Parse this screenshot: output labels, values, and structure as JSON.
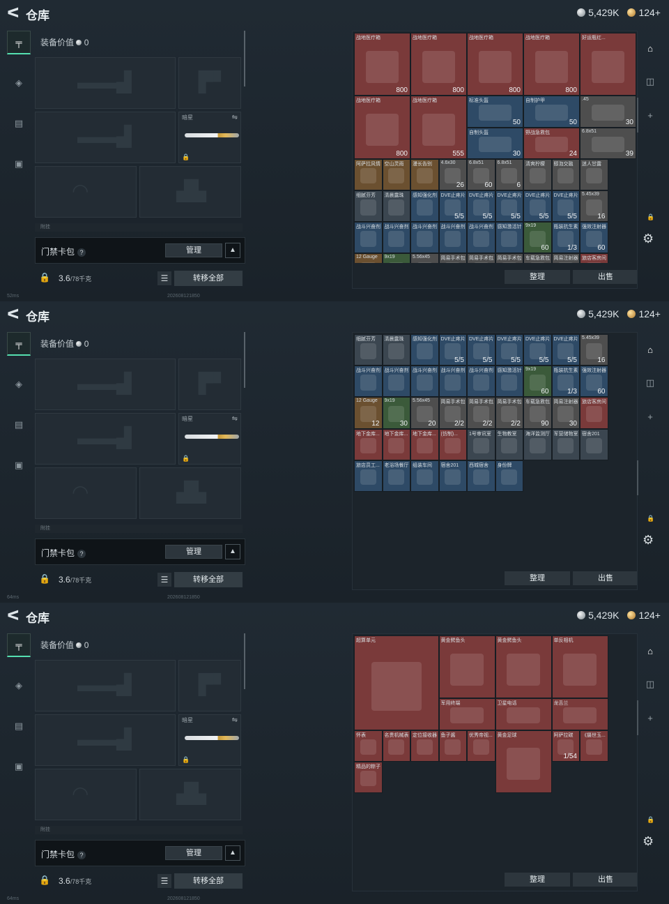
{
  "app": {
    "back_glyph": "ᐸ",
    "title": "仓库"
  },
  "currency": {
    "silver": "5,429K",
    "gold": "124+"
  },
  "loadout": {
    "equip_label": "装备价值",
    "equip_value": "0",
    "knife_slot_label": "暗星",
    "pouch_label": "附挂",
    "access_label": "门禁卡包",
    "access_help": "?",
    "manage_label": "管理",
    "weight": "3.6",
    "weight_max": "/78千克",
    "transfer_label": "转移全部"
  },
  "stash_toolbar": {
    "sort_label": "整理",
    "sell_label": "出售"
  },
  "status": {
    "ping1": "52ms",
    "ping2": "64ms",
    "ping3": "64ms",
    "stamp": "202608121850"
  },
  "left_icons": [
    "pistol-icon",
    "armor-icon",
    "backpack-icon",
    "briefcase-icon"
  ],
  "right_icons": [
    "vault-icon",
    "camera-icon",
    "plus-icon",
    "lock-icon",
    "gear-icon"
  ],
  "panels": [
    {
      "cells": [
        {
          "n": "战地医疗箱",
          "c": "800",
          "col": 0,
          "row": 0,
          "w": 1,
          "h": 2,
          "bg": "#7a3a3a"
        },
        {
          "n": "战地医疗箱",
          "c": "800",
          "col": 1,
          "row": 0,
          "w": 1,
          "h": 2,
          "bg": "#7a3a3a"
        },
        {
          "n": "战地医疗箱",
          "c": "800",
          "col": 2,
          "row": 0,
          "w": 1,
          "h": 2,
          "bg": "#7a3a3a"
        },
        {
          "n": "战地医疗箱",
          "c": "800",
          "col": 3,
          "row": 0,
          "w": 1,
          "h": 2,
          "bg": "#7a3a3a"
        },
        {
          "n": "好运瓶红...",
          "c": "",
          "col": 4,
          "row": 0,
          "w": 1,
          "h": 2,
          "bg": "#7a3a3a"
        },
        {
          "n": "战地医疗箱",
          "c": "800",
          "col": 0,
          "row": 2,
          "w": 1,
          "h": 2,
          "bg": "#7a3a3a"
        },
        {
          "n": "战地医疗箱",
          "c": "555",
          "col": 1,
          "row": 2,
          "w": 1,
          "h": 2,
          "bg": "#7a3a3a"
        },
        {
          "n": "标准头盔",
          "c": "50",
          "col": 2,
          "row": 2,
          "w": 1,
          "h": 1,
          "bg": "#2e4a66"
        },
        {
          "n": "自制护甲",
          "c": "50",
          "col": 3,
          "row": 2,
          "w": 1,
          "h": 1,
          "bg": "#2e4a66"
        },
        {
          "n": ".45",
          "c": "30",
          "col": 4,
          "row": 2,
          "w": 1,
          "h": 1,
          "bg": "#4e4e4e"
        },
        {
          "n": "自制头盔",
          "c": "30",
          "col": 2,
          "row": 3,
          "w": 1,
          "h": 1,
          "bg": "#2e4a66"
        },
        {
          "n": "野战急救包",
          "c": "24",
          "col": 3,
          "row": 3,
          "w": 1,
          "h": 1,
          "bg": "#7a3a3a"
        },
        {
          "n": "6.8x51",
          "c": "39",
          "col": 4,
          "row": 3,
          "w": 1,
          "h": 1,
          "bg": "#4e4e4e"
        },
        {
          "n": "阿萨拉风情",
          "c": "",
          "col": 0,
          "row": 4,
          "w": 0.5,
          "h": 1,
          "bg": "#6b5030"
        },
        {
          "n": "空山灵雨",
          "c": "",
          "col": 0.5,
          "row": 4,
          "w": 0.5,
          "h": 1,
          "bg": "#6b5030"
        },
        {
          "n": "漫长告别",
          "c": "",
          "col": 1,
          "row": 4,
          "w": 0.5,
          "h": 1,
          "bg": "#6b5030"
        },
        {
          "n": "4.6x30",
          "c": "26",
          "col": 1.5,
          "row": 4,
          "w": 0.5,
          "h": 1,
          "bg": "#4e4e4e"
        },
        {
          "n": "6.8x51",
          "c": "60",
          "col": 2,
          "row": 4,
          "w": 0.5,
          "h": 1,
          "bg": "#4e4e4e"
        },
        {
          "n": "6.8x51",
          "c": "6",
          "col": 2.5,
          "row": 4,
          "w": 0.5,
          "h": 1,
          "bg": "#4e4e4e"
        },
        {
          "n": "清爽柠檬",
          "c": "",
          "col": 3,
          "row": 4,
          "w": 0.5,
          "h": 1,
          "bg": "#4e4e4e"
        },
        {
          "n": "醇泡交融",
          "c": "",
          "col": 3.5,
          "row": 4,
          "w": 0.5,
          "h": 1,
          "bg": "#4e4e4e"
        },
        {
          "n": "迷人甘露",
          "c": "",
          "col": 4,
          "row": 4,
          "w": 0.5,
          "h": 1,
          "bg": "#4e4e4e"
        },
        {
          "n": "细腻芬芳",
          "c": "",
          "col": 0,
          "row": 5,
          "w": 0.5,
          "h": 1,
          "bg": "#3b4650"
        },
        {
          "n": "清晨露珠",
          "c": "",
          "col": 0.5,
          "row": 5,
          "w": 0.5,
          "h": 1,
          "bg": "#3b4650"
        },
        {
          "n": "感知强化剂",
          "c": "",
          "col": 1,
          "row": 5,
          "w": 0.5,
          "h": 1,
          "bg": "#2e4a66"
        },
        {
          "n": "DVE止疼片",
          "c": "5/5",
          "col": 1.5,
          "row": 5,
          "w": 0.5,
          "h": 1,
          "bg": "#2e4a66"
        },
        {
          "n": "DVE止疼片",
          "c": "5/5",
          "col": 2,
          "row": 5,
          "w": 0.5,
          "h": 1,
          "bg": "#2e4a66"
        },
        {
          "n": "DVE止疼片",
          "c": "5/5",
          "col": 2.5,
          "row": 5,
          "w": 0.5,
          "h": 1,
          "bg": "#2e4a66"
        },
        {
          "n": "DVE止疼片",
          "c": "5/5",
          "col": 3,
          "row": 5,
          "w": 0.5,
          "h": 1,
          "bg": "#2e4a66"
        },
        {
          "n": "DVE止疼片",
          "c": "5/5",
          "col": 3.5,
          "row": 5,
          "w": 0.5,
          "h": 1,
          "bg": "#2e4a66"
        },
        {
          "n": "5.45x39",
          "c": "16",
          "col": 4,
          "row": 5,
          "w": 0.5,
          "h": 1,
          "bg": "#4e4e4e"
        },
        {
          "n": "战斗兴奋剂",
          "c": "",
          "col": 0,
          "row": 6,
          "w": 0.5,
          "h": 1,
          "bg": "#2e4a66"
        },
        {
          "n": "战斗兴奋剂",
          "c": "",
          "col": 0.5,
          "row": 6,
          "w": 0.5,
          "h": 1,
          "bg": "#2e4a66"
        },
        {
          "n": "战斗兴奋剂",
          "c": "",
          "col": 1,
          "row": 6,
          "w": 0.5,
          "h": 1,
          "bg": "#2e4a66"
        },
        {
          "n": "战斗兴奋剂",
          "c": "",
          "col": 1.5,
          "row": 6,
          "w": 0.5,
          "h": 1,
          "bg": "#2e4a66"
        },
        {
          "n": "战斗兴奋剂",
          "c": "",
          "col": 2,
          "row": 6,
          "w": 0.5,
          "h": 1,
          "bg": "#2e4a66"
        },
        {
          "n": "感知激活针",
          "c": "",
          "col": 2.5,
          "row": 6,
          "w": 0.5,
          "h": 1,
          "bg": "#2e4a66"
        },
        {
          "n": "9x19",
          "c": "60",
          "col": 3,
          "row": 6,
          "w": 0.5,
          "h": 1,
          "bg": "#3b5a3a"
        },
        {
          "n": "瓶装抗生素",
          "c": "1/3",
          "col": 3.5,
          "row": 6,
          "w": 0.5,
          "h": 1,
          "bg": "#2e4a66"
        },
        {
          "n": "强效注射器",
          "c": "60",
          "col": 4,
          "row": 6,
          "w": 0.5,
          "h": 1,
          "bg": "#2e4a66"
        },
        {
          "n": "12 Gauge",
          "c": "",
          "col": 0,
          "row": 7,
          "w": 0.5,
          "h": 1,
          "bg": "#6b5030"
        },
        {
          "n": "9x19",
          "c": "",
          "col": 0.5,
          "row": 7,
          "w": 0.5,
          "h": 1,
          "bg": "#3b5a3a"
        },
        {
          "n": "5.56x45",
          "c": "",
          "col": 1,
          "row": 7,
          "w": 0.5,
          "h": 1,
          "bg": "#4e4e4e"
        },
        {
          "n": "简易手术包",
          "c": "",
          "col": 1.5,
          "row": 7,
          "w": 0.5,
          "h": 1,
          "bg": "#4e4e4e"
        },
        {
          "n": "简易手术包",
          "c": "",
          "col": 2,
          "row": 7,
          "w": 0.5,
          "h": 1,
          "bg": "#4e4e4e"
        },
        {
          "n": "简易手术包",
          "c": "",
          "col": 2.5,
          "row": 7,
          "w": 0.5,
          "h": 1,
          "bg": "#4e4e4e"
        },
        {
          "n": "车载急救包",
          "c": "",
          "col": 3,
          "row": 7,
          "w": 0.5,
          "h": 1,
          "bg": "#4e4e4e"
        },
        {
          "n": "简易注射器",
          "c": "",
          "col": 3.5,
          "row": 7,
          "w": 0.5,
          "h": 1,
          "bg": "#4e4e4e"
        },
        {
          "n": "旅店客房间",
          "c": "",
          "col": 4,
          "row": 7,
          "w": 0.5,
          "h": 1,
          "bg": "#7a3a3a"
        }
      ]
    },
    {
      "cells": [
        {
          "n": "细腻芬芳",
          "c": "",
          "col": 0,
          "row": 0,
          "w": 0.5,
          "h": 1,
          "bg": "#3b4650"
        },
        {
          "n": "清晨露珠",
          "c": "",
          "col": 0.5,
          "row": 0,
          "w": 0.5,
          "h": 1,
          "bg": "#3b4650"
        },
        {
          "n": "感知强化剂",
          "c": "",
          "col": 1,
          "row": 0,
          "w": 0.5,
          "h": 1,
          "bg": "#2e4a66"
        },
        {
          "n": "DVE止疼片",
          "c": "5/5",
          "col": 1.5,
          "row": 0,
          "w": 0.5,
          "h": 1,
          "bg": "#2e4a66"
        },
        {
          "n": "DVE止疼片",
          "c": "5/5",
          "col": 2,
          "row": 0,
          "w": 0.5,
          "h": 1,
          "bg": "#2e4a66"
        },
        {
          "n": "DVE止疼片",
          "c": "5/5",
          "col": 2.5,
          "row": 0,
          "w": 0.5,
          "h": 1,
          "bg": "#2e4a66"
        },
        {
          "n": "DVE止疼片",
          "c": "5/5",
          "col": 3,
          "row": 0,
          "w": 0.5,
          "h": 1,
          "bg": "#2e4a66"
        },
        {
          "n": "DVE止疼片",
          "c": "5/5",
          "col": 3.5,
          "row": 0,
          "w": 0.5,
          "h": 1,
          "bg": "#2e4a66"
        },
        {
          "n": "5.45x39",
          "c": "16",
          "col": 4,
          "row": 0,
          "w": 0.5,
          "h": 1,
          "bg": "#4e4e4e"
        },
        {
          "n": "战斗兴奋剂",
          "c": "",
          "col": 0,
          "row": 1,
          "w": 0.5,
          "h": 1,
          "bg": "#2e4a66"
        },
        {
          "n": "战斗兴奋剂",
          "c": "",
          "col": 0.5,
          "row": 1,
          "w": 0.5,
          "h": 1,
          "bg": "#2e4a66"
        },
        {
          "n": "战斗兴奋剂",
          "c": "",
          "col": 1,
          "row": 1,
          "w": 0.5,
          "h": 1,
          "bg": "#2e4a66"
        },
        {
          "n": "战斗兴奋剂",
          "c": "",
          "col": 1.5,
          "row": 1,
          "w": 0.5,
          "h": 1,
          "bg": "#2e4a66"
        },
        {
          "n": "战斗兴奋剂",
          "c": "",
          "col": 2,
          "row": 1,
          "w": 0.5,
          "h": 1,
          "bg": "#2e4a66"
        },
        {
          "n": "感知激活针",
          "c": "",
          "col": 2.5,
          "row": 1,
          "w": 0.5,
          "h": 1,
          "bg": "#2e4a66"
        },
        {
          "n": "9x19",
          "c": "60",
          "col": 3,
          "row": 1,
          "w": 0.5,
          "h": 1,
          "bg": "#3b5a3a"
        },
        {
          "n": "瓶装抗生素",
          "c": "1/3",
          "col": 3.5,
          "row": 1,
          "w": 0.5,
          "h": 1,
          "bg": "#2e4a66"
        },
        {
          "n": "强效注射器",
          "c": "60",
          "col": 4,
          "row": 1,
          "w": 0.5,
          "h": 1,
          "bg": "#2e4a66"
        },
        {
          "n": "12 Gauge",
          "c": "12",
          "col": 0,
          "row": 2,
          "w": 0.5,
          "h": 1,
          "bg": "#6b5030"
        },
        {
          "n": "9x19",
          "c": "30",
          "col": 0.5,
          "row": 2,
          "w": 0.5,
          "h": 1,
          "bg": "#3b5a3a"
        },
        {
          "n": "5.56x45",
          "c": "20",
          "col": 1,
          "row": 2,
          "w": 0.5,
          "h": 1,
          "bg": "#4e4e4e"
        },
        {
          "n": "简易手术包",
          "c": "2/2",
          "col": 1.5,
          "row": 2,
          "w": 0.5,
          "h": 1,
          "bg": "#4e4e4e"
        },
        {
          "n": "简易手术包",
          "c": "2/2",
          "col": 2,
          "row": 2,
          "w": 0.5,
          "h": 1,
          "bg": "#4e4e4e"
        },
        {
          "n": "简易手术包",
          "c": "2/2",
          "col": 2.5,
          "row": 2,
          "w": 0.5,
          "h": 1,
          "bg": "#4e4e4e"
        },
        {
          "n": "车载急救包",
          "c": "90",
          "col": 3,
          "row": 2,
          "w": 0.5,
          "h": 1,
          "bg": "#4e4e4e"
        },
        {
          "n": "简易注射器",
          "c": "30",
          "col": 3.5,
          "row": 2,
          "w": 0.5,
          "h": 1,
          "bg": "#4e4e4e"
        },
        {
          "n": "旅店客房间",
          "c": "",
          "col": 4,
          "row": 2,
          "w": 0.5,
          "h": 1,
          "bg": "#7a3a3a"
        },
        {
          "n": "地下金库...",
          "c": "",
          "col": 0,
          "row": 3,
          "w": 0.5,
          "h": 1,
          "bg": "#7a3a3a"
        },
        {
          "n": "地下金库...",
          "c": "",
          "col": 0.5,
          "row": 3,
          "w": 0.5,
          "h": 1,
          "bg": "#7a3a3a"
        },
        {
          "n": "地下金库...",
          "c": "",
          "col": 1,
          "row": 3,
          "w": 0.5,
          "h": 1,
          "bg": "#7a3a3a"
        },
        {
          "n": "(仿制)...",
          "c": "",
          "col": 1.5,
          "row": 3,
          "w": 0.5,
          "h": 1,
          "bg": "#7a3a3a"
        },
        {
          "n": "1号审讯室",
          "c": "",
          "col": 2,
          "row": 3,
          "w": 0.5,
          "h": 1,
          "bg": "#3b4650"
        },
        {
          "n": "生物教室",
          "c": "",
          "col": 2.5,
          "row": 3,
          "w": 0.5,
          "h": 1,
          "bg": "#3b4650"
        },
        {
          "n": "海洋监测厅",
          "c": "",
          "col": 3,
          "row": 3,
          "w": 0.5,
          "h": 1,
          "bg": "#3b4650"
        },
        {
          "n": "军营储物室",
          "c": "",
          "col": 3.5,
          "row": 3,
          "w": 0.5,
          "h": 1,
          "bg": "#3b4650"
        },
        {
          "n": "宿舍201",
          "c": "",
          "col": 4,
          "row": 3,
          "w": 0.5,
          "h": 1,
          "bg": "#3b4650"
        },
        {
          "n": "旅店员工...",
          "c": "",
          "col": 0,
          "row": 4,
          "w": 0.5,
          "h": 1,
          "bg": "#2e4a66"
        },
        {
          "n": "老浴场餐厅",
          "c": "",
          "col": 0.5,
          "row": 4,
          "w": 0.5,
          "h": 1,
          "bg": "#2e4a66"
        },
        {
          "n": "组装车间",
          "c": "",
          "col": 1,
          "row": 4,
          "w": 0.5,
          "h": 1,
          "bg": "#2e4a66"
        },
        {
          "n": "宿舍201",
          "c": "",
          "col": 1.5,
          "row": 4,
          "w": 0.5,
          "h": 1,
          "bg": "#2e4a66"
        },
        {
          "n": "西城宿舍",
          "c": "",
          "col": 2,
          "row": 4,
          "w": 0.5,
          "h": 1,
          "bg": "#2e4a66"
        },
        {
          "n": "身份牌",
          "c": "",
          "col": 2.5,
          "row": 4,
          "w": 0.5,
          "h": 1,
          "bg": "#2e4a66"
        }
      ]
    },
    {
      "cells": [
        {
          "n": "超算单元",
          "c": "",
          "col": 0,
          "row": 0,
          "w": 1.5,
          "h": 3,
          "bg": "#7a3a3a"
        },
        {
          "n": "黄金鳄鱼头",
          "c": "",
          "col": 1.5,
          "row": 0,
          "w": 1,
          "h": 2,
          "bg": "#7a3a3a"
        },
        {
          "n": "黄金鳄鱼头",
          "c": "",
          "col": 2.5,
          "row": 0,
          "w": 1,
          "h": 2,
          "bg": "#7a3a3a"
        },
        {
          "n": "单反相机",
          "c": "",
          "col": 3.5,
          "row": 0,
          "w": 1,
          "h": 2,
          "bg": "#7a3a3a"
        },
        {
          "n": "军用终端",
          "c": "",
          "col": 1.5,
          "row": 2,
          "w": 1,
          "h": 1,
          "bg": "#7a3a3a"
        },
        {
          "n": "卫星电话",
          "c": "",
          "col": 2.5,
          "row": 2,
          "w": 1,
          "h": 1,
          "bg": "#7a3a3a"
        },
        {
          "n": "龙舌兰",
          "c": "",
          "col": 3.5,
          "row": 2,
          "w": 1,
          "h": 1,
          "bg": "#7a3a3a"
        },
        {
          "n": "怀表",
          "c": "",
          "col": 0,
          "row": 3,
          "w": 0.5,
          "h": 1,
          "bg": "#7a3a3a"
        },
        {
          "n": "名贵机械表",
          "c": "",
          "col": 0.5,
          "row": 3,
          "w": 0.5,
          "h": 1,
          "bg": "#7a3a3a"
        },
        {
          "n": "定位接收器",
          "c": "",
          "col": 1,
          "row": 3,
          "w": 0.5,
          "h": 1,
          "bg": "#7a3a3a"
        },
        {
          "n": "鱼子酱",
          "c": "",
          "col": 1.5,
          "row": 3,
          "w": 0.5,
          "h": 1,
          "bg": "#7a3a3a"
        },
        {
          "n": "优秀帝视...",
          "c": "",
          "col": 2,
          "row": 3,
          "w": 0.5,
          "h": 1,
          "bg": "#7a3a3a"
        },
        {
          "n": "黄金足球",
          "c": "",
          "col": 2.5,
          "row": 3,
          "w": 1,
          "h": 2,
          "bg": "#7a3a3a"
        },
        {
          "n": "阿萨拉碳",
          "c": "1/54",
          "col": 3.5,
          "row": 3,
          "w": 0.5,
          "h": 1,
          "bg": "#7a3a3a"
        },
        {
          "n": "《摄世玉...",
          "c": "",
          "col": 4,
          "row": 3,
          "w": 0.5,
          "h": 1,
          "bg": "#7a3a3a"
        },
        {
          "n": "精品的粽子",
          "c": "",
          "col": 0,
          "row": 4,
          "w": 0.5,
          "h": 1,
          "bg": "#7a3a3a"
        }
      ]
    }
  ]
}
